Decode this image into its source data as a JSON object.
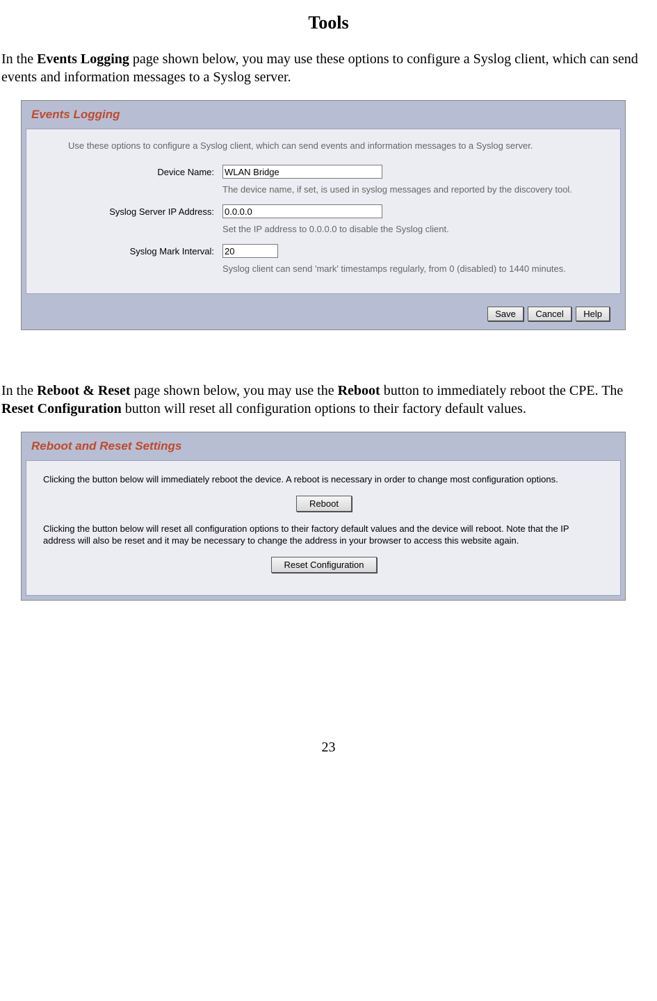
{
  "page": {
    "title": "Tools",
    "number": "23"
  },
  "intro1": {
    "pre": "In the ",
    "bold1": "Events Logging",
    "post": " page shown below, you may use these options to configure a Syslog client, which can send events and information messages to a Syslog server."
  },
  "panel1": {
    "title": "Events Logging",
    "intro": "Use these options to configure a Syslog client, which can send events and information messages to a Syslog server.",
    "device_name_label": "Device Name:",
    "device_name_value": "WLAN Bridge",
    "device_name_help": "The device name, if set, is used in syslog messages and reported by the discovery tool.",
    "syslog_ip_label": "Syslog Server IP Address:",
    "syslog_ip_value": "0.0.0.0",
    "syslog_ip_help": "Set the IP address to 0.0.0.0 to disable the Syslog client.",
    "mark_interval_label": "Syslog Mark Interval:",
    "mark_interval_value": "20",
    "mark_interval_help": "Syslog client can send 'mark' timestamps regularly, from 0 (disabled) to 1440 minutes.",
    "buttons": {
      "save": "Save",
      "cancel": "Cancel",
      "help": "Help"
    }
  },
  "intro2": {
    "pre": "In the ",
    "bold1": "Reboot & Reset",
    "mid1": " page shown below, you may use the ",
    "bold2": "Reboot",
    "mid2": " button to immediately reboot the CPE.  The ",
    "bold3": "Reset Configuration",
    "post": " button will reset all configuration options to their factory default values."
  },
  "panel2": {
    "title": "Reboot and Reset Settings",
    "text1": "Clicking the button below will immediately reboot the device. A reboot is necessary in order to change most configuration options.",
    "reboot_btn": "Reboot",
    "text2": "Clicking the button below will reset all configuration options to their factory default values and the device will reboot. Note that the IP address will also be reset and it may be necessary to change the address in your browser to access this website again.",
    "reset_btn": "Reset Configuration"
  }
}
